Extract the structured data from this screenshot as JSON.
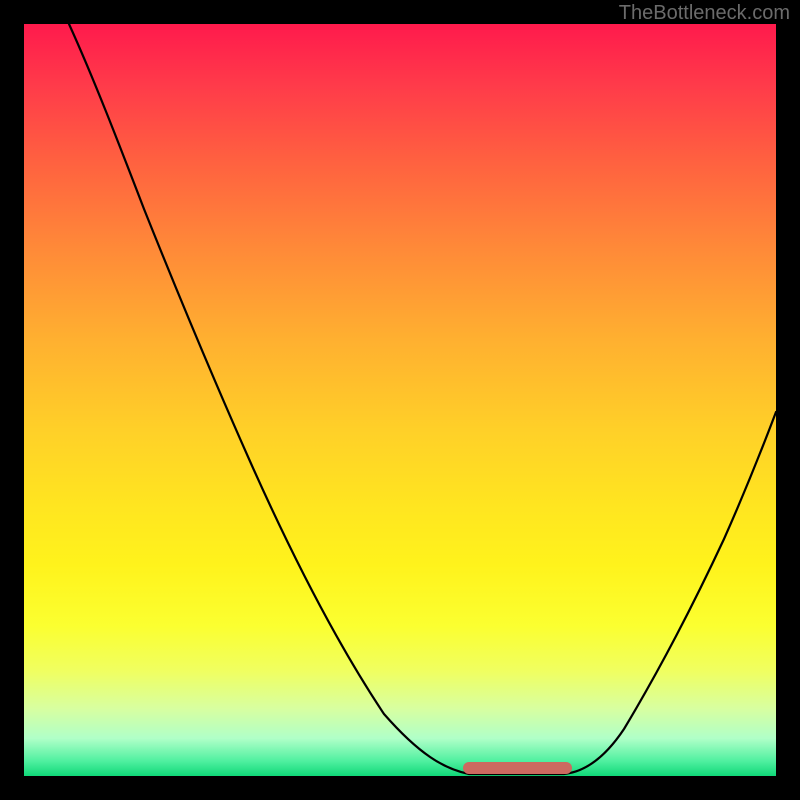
{
  "watermark": "TheBottleneck.com",
  "colors": {
    "background": "#000000",
    "curve": "#000000",
    "flat_marker": "#cc6a60",
    "gradient_top": "#ff1a4c",
    "gradient_bottom": "#10d878"
  },
  "chart_data": {
    "type": "line",
    "title": "",
    "xlabel": "",
    "ylabel": "",
    "xlim": [
      0,
      100
    ],
    "ylim": [
      0,
      100
    ],
    "grid": false,
    "annotations": [
      "TheBottleneck.com"
    ],
    "series": [
      {
        "name": "bottleneck-curve",
        "x": [
          6,
          10,
          15,
          20,
          25,
          30,
          35,
          40,
          45,
          50,
          55,
          58,
          62,
          66,
          70,
          72,
          76,
          80,
          85,
          90,
          95,
          100
        ],
        "y": [
          100,
          92,
          83,
          74,
          65,
          56,
          47,
          38,
          29,
          20,
          11,
          5,
          1,
          0,
          0,
          1,
          5,
          12,
          21,
          30,
          40,
          50
        ]
      }
    ],
    "flat_marker": {
      "x_start": 62,
      "x_end": 72,
      "y": 0
    }
  }
}
